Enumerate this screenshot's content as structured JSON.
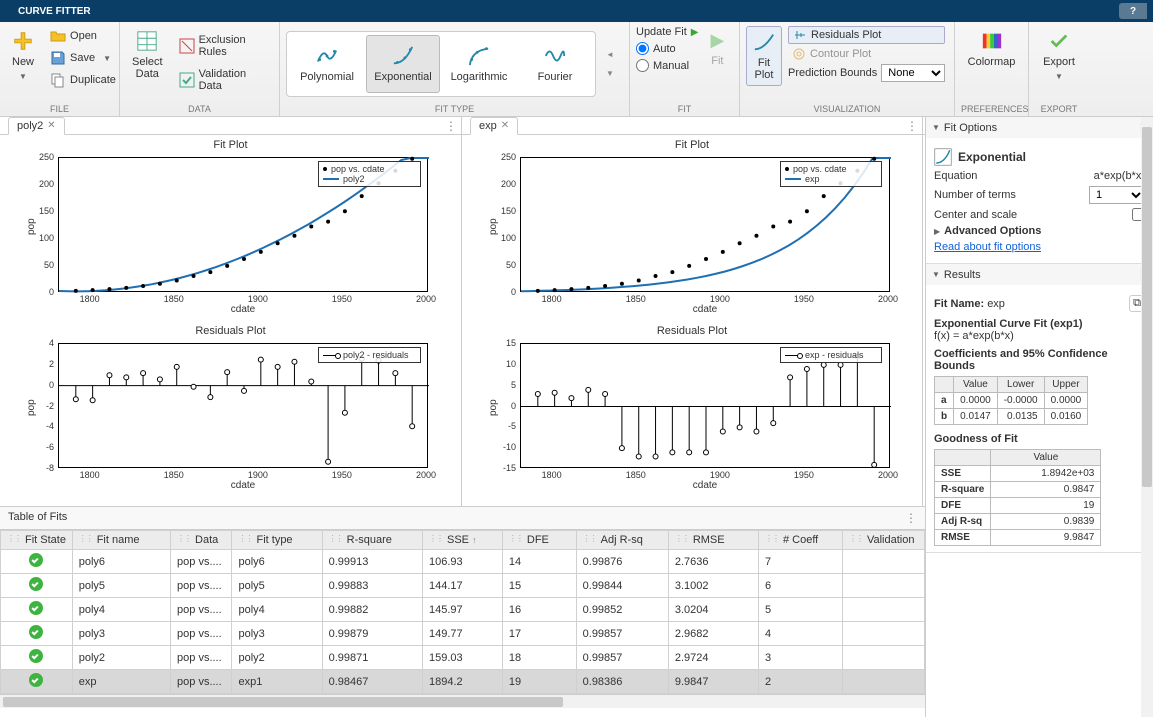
{
  "titlebar": {
    "tab": "CURVE FITTER"
  },
  "ribbon": {
    "file": {
      "label": "FILE",
      "new": "New",
      "open": "Open",
      "save": "Save",
      "duplicate": "Duplicate"
    },
    "data": {
      "label": "DATA",
      "select": "Select\nData",
      "exclusion": "Exclusion Rules",
      "validation": "Validation Data"
    },
    "fittype": {
      "label": "FIT TYPE",
      "polynomial": "Polynomial",
      "exponential": "Exponential",
      "logarithmic": "Logarithmic",
      "fourier": "Fourier"
    },
    "fit": {
      "label": "FIT",
      "update": "Update Fit",
      "auto": "Auto",
      "manual": "Manual",
      "fit": "Fit"
    },
    "vis": {
      "label": "VISUALIZATION",
      "fitplot": "Fit\nPlot",
      "residuals": "Residuals Plot",
      "contour": "Contour Plot",
      "pred": "Prediction Bounds",
      "pred_val": "None"
    },
    "prefs": {
      "label": "PREFERENCES",
      "colormap": "Colormap"
    },
    "export": {
      "label": "EXPORT",
      "export": "Export"
    }
  },
  "tabs": {
    "left": "poly2",
    "right": "exp"
  },
  "chart_data": [
    {
      "type": "scatter+line",
      "title": "Fit Plot",
      "xlabel": "cdate",
      "ylabel": "pop",
      "legend": [
        "pop vs. cdate",
        "poly2"
      ],
      "xlim": [
        1780,
        2000
      ],
      "ylim": [
        0,
        250
      ],
      "xticks": [
        1800,
        1850,
        1900,
        1950,
        2000
      ],
      "yticks": [
        0,
        50,
        100,
        150,
        200,
        250
      ],
      "x": [
        1790,
        1800,
        1810,
        1820,
        1830,
        1840,
        1850,
        1860,
        1870,
        1880,
        1890,
        1900,
        1910,
        1920,
        1930,
        1940,
        1950,
        1960,
        1970,
        1980,
        1990
      ],
      "y": [
        3.9,
        5.3,
        7.2,
        9.6,
        12.9,
        17.1,
        23.2,
        31.4,
        38.6,
        50.2,
        63.0,
        76.2,
        92.2,
        106.0,
        123.2,
        132.2,
        151.3,
        179.3,
        203.3,
        226.5,
        248.7
      ]
    },
    {
      "type": "stem",
      "title": "Residuals Plot",
      "xlabel": "cdate",
      "ylabel": "pop",
      "legend": [
        "poly2 - residuals"
      ],
      "xlim": [
        1780,
        2000
      ],
      "ylim": [
        -8,
        4
      ],
      "xticks": [
        1800,
        1850,
        1900,
        1950,
        2000
      ],
      "yticks": [
        -8,
        -6,
        -4,
        -2,
        0,
        2,
        4
      ],
      "x": [
        1790,
        1800,
        1810,
        1820,
        1830,
        1840,
        1850,
        1860,
        1870,
        1880,
        1890,
        1900,
        1910,
        1920,
        1930,
        1940,
        1950,
        1960,
        1970,
        1980,
        1990
      ],
      "y": [
        -1.3,
        -1.4,
        1.0,
        0.8,
        1.2,
        0.6,
        1.8,
        -0.1,
        -1.1,
        1.3,
        -0.5,
        2.5,
        1.8,
        2.3,
        0.4,
        -7.3,
        -2.6,
        2.6,
        2.4,
        1.2,
        -3.9
      ]
    },
    {
      "type": "scatter+line",
      "title": "Fit Plot",
      "xlabel": "cdate",
      "ylabel": "pop",
      "legend": [
        "pop vs. cdate",
        "exp"
      ],
      "xlim": [
        1780,
        2000
      ],
      "ylim": [
        0,
        250
      ],
      "xticks": [
        1800,
        1850,
        1900,
        1950,
        2000
      ],
      "yticks": [
        0,
        50,
        100,
        150,
        200,
        250
      ],
      "x": [
        1790,
        1800,
        1810,
        1820,
        1830,
        1840,
        1850,
        1860,
        1870,
        1880,
        1890,
        1900,
        1910,
        1920,
        1930,
        1940,
        1950,
        1960,
        1970,
        1980,
        1990
      ],
      "y": [
        3.9,
        5.3,
        7.2,
        9.6,
        12.9,
        17.1,
        23.2,
        31.4,
        38.6,
        50.2,
        63.0,
        76.2,
        92.2,
        106.0,
        123.2,
        132.2,
        151.3,
        179.3,
        203.3,
        226.5,
        248.7
      ]
    },
    {
      "type": "stem",
      "title": "Residuals Plot",
      "xlabel": "cdate",
      "ylabel": "pop",
      "legend": [
        "exp - residuals"
      ],
      "xlim": [
        1780,
        2000
      ],
      "ylim": [
        -15,
        15
      ],
      "xticks": [
        1800,
        1850,
        1900,
        1950,
        2000
      ],
      "yticks": [
        -15,
        -10,
        -5,
        0,
        5,
        10,
        15
      ],
      "x": [
        1790,
        1800,
        1810,
        1820,
        1830,
        1840,
        1850,
        1860,
        1870,
        1880,
        1890,
        1900,
        1910,
        1920,
        1930,
        1940,
        1950,
        1960,
        1970,
        1980,
        1990
      ],
      "y": [
        3.0,
        3.3,
        2.0,
        4.0,
        3.0,
        -10.0,
        -12.0,
        -12.0,
        -11.0,
        -11.0,
        -11.0,
        -6.0,
        -5.0,
        -6.0,
        -4.0,
        7.0,
        9.0,
        10.0,
        10.0,
        12.0,
        -14.0
      ]
    }
  ],
  "tof": {
    "title": "Table of Fits",
    "cols": [
      "Fit State",
      "Fit name",
      "Data",
      "Fit type",
      "R-square",
      "SSE",
      "DFE",
      "Adj R-sq",
      "RMSE",
      "# Coeff",
      "Validation"
    ],
    "rows": [
      {
        "name": "poly6",
        "data": "pop vs....",
        "type": "poly6",
        "r2": "0.99913",
        "sse": "106.93",
        "dfe": "14",
        "adj": "0.99876",
        "rmse": "2.7636",
        "nc": "7"
      },
      {
        "name": "poly5",
        "data": "pop vs....",
        "type": "poly5",
        "r2": "0.99883",
        "sse": "144.17",
        "dfe": "15",
        "adj": "0.99844",
        "rmse": "3.1002",
        "nc": "6"
      },
      {
        "name": "poly4",
        "data": "pop vs....",
        "type": "poly4",
        "r2": "0.99882",
        "sse": "145.97",
        "dfe": "16",
        "adj": "0.99852",
        "rmse": "3.0204",
        "nc": "5"
      },
      {
        "name": "poly3",
        "data": "pop vs....",
        "type": "poly3",
        "r2": "0.99879",
        "sse": "149.77",
        "dfe": "17",
        "adj": "0.99857",
        "rmse": "2.9682",
        "nc": "4"
      },
      {
        "name": "poly2",
        "data": "pop vs....",
        "type": "poly2",
        "r2": "0.99871",
        "sse": "159.03",
        "dfe": "18",
        "adj": "0.99857",
        "rmse": "2.9724",
        "nc": "3"
      },
      {
        "name": "exp",
        "data": "pop vs....",
        "type": "exp1",
        "r2": "0.98467",
        "sse": "1894.2",
        "dfe": "19",
        "adj": "0.98386",
        "rmse": "9.9847",
        "nc": "2"
      }
    ]
  },
  "fitopts": {
    "title": "Fit Options",
    "model": "Exponential",
    "eq_label": "Equation",
    "eq": "a*exp(b*x)",
    "nt_label": "Number of terms",
    "nt": "1",
    "cs_label": "Center and scale",
    "adv": "Advanced Options",
    "read": "Read about fit options"
  },
  "results": {
    "title": "Results",
    "fitname_l": "Fit Name:",
    "fitname": "exp",
    "modeltitle": "Exponential Curve Fit (exp1)",
    "eq": "f(x) = a*exp(b*x)",
    "coef_title": "Coefficients and 95% Confidence Bounds",
    "coefs": {
      "hdr": [
        "",
        "Value",
        "Lower",
        "Upper"
      ],
      "rows": [
        [
          "a",
          "0.0000",
          "-0.0000",
          "0.0000"
        ],
        [
          "b",
          "0.0147",
          "0.0135",
          "0.0160"
        ]
      ]
    },
    "gof_title": "Goodness of Fit",
    "gof": {
      "hdr": [
        "",
        "Value"
      ],
      "rows": [
        [
          "SSE",
          "1.8942e+03"
        ],
        [
          "R-square",
          "0.9847"
        ],
        [
          "DFE",
          "19"
        ],
        [
          "Adj R-sq",
          "0.9839"
        ],
        [
          "RMSE",
          "9.9847"
        ]
      ]
    }
  }
}
